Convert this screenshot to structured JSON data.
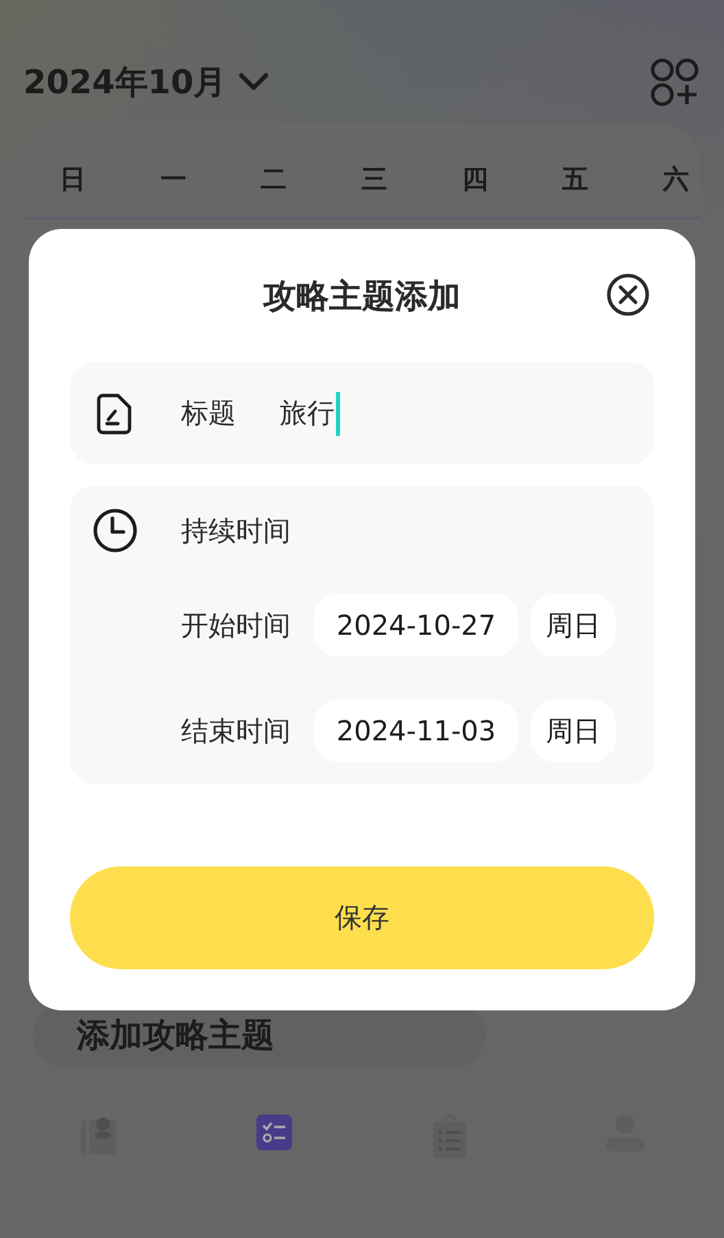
{
  "header": {
    "month": "2024年10月"
  },
  "calendar": {
    "weekdays": [
      "日",
      "一",
      "二",
      "三",
      "四",
      "五",
      "六"
    ]
  },
  "add_button": {
    "label": "添加攻略主题"
  },
  "bottom_nav": [
    {
      "selected": false
    },
    {
      "selected": true
    },
    {
      "selected": false
    },
    {
      "selected": false
    }
  ],
  "dialog": {
    "title": "攻略主题添加",
    "title_row": {
      "label": "标题",
      "value": "旅行"
    },
    "duration": {
      "label": "持续时间",
      "rows": [
        {
          "label": "开始时间",
          "date": "2024-10-27",
          "weekday": "周日"
        },
        {
          "label": "结束时间",
          "date": "2024-11-03",
          "weekday": "周日"
        }
      ]
    },
    "save": "保存"
  }
}
